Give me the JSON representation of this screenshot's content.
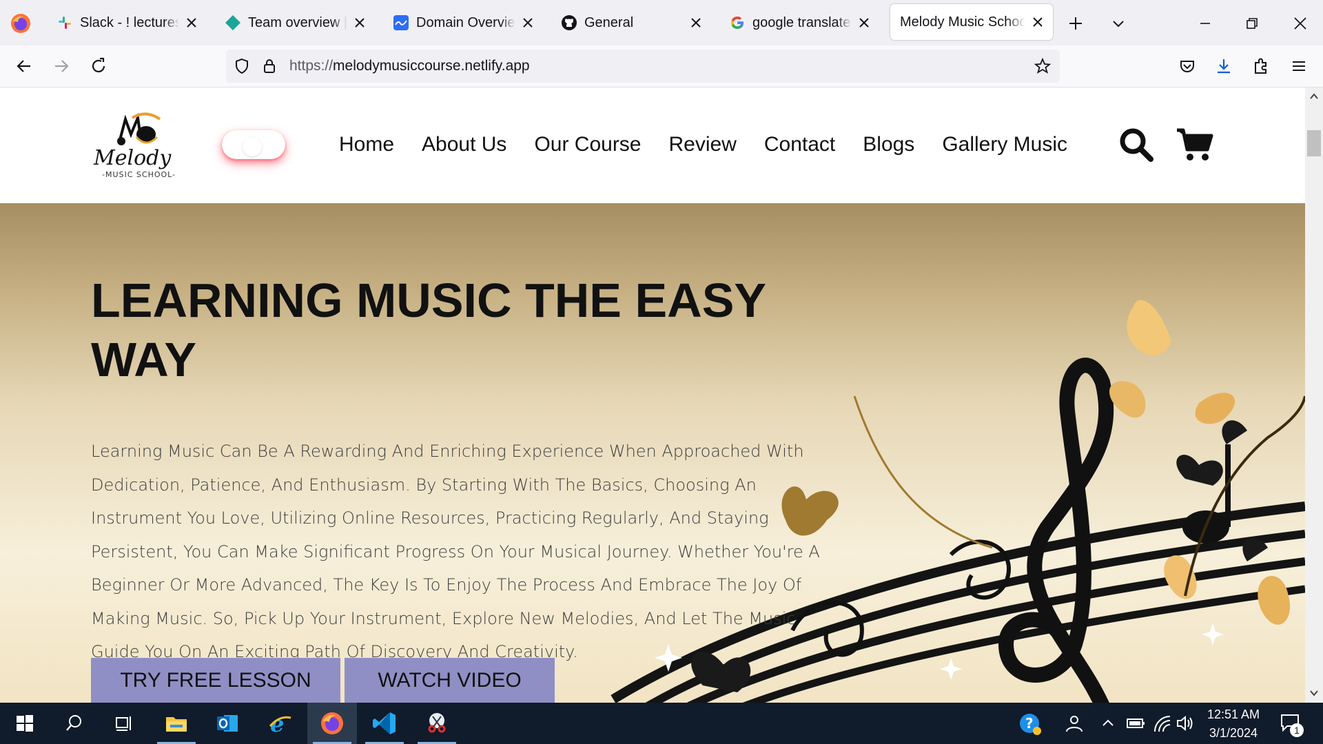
{
  "browser": {
    "tabs": [
      {
        "title": "Slack - ! lectures - F",
        "icon": "slack-icon"
      },
      {
        "title": "Team overview | nov",
        "icon": "diamond-icon"
      },
      {
        "title": "Domain Overview | S",
        "icon": "semrush-icon"
      },
      {
        "title": "General",
        "icon": "github-icon"
      },
      {
        "title": "google translate - P",
        "icon": "google-icon"
      },
      {
        "title": "Melody Music School",
        "icon": "none",
        "active": true
      }
    ],
    "url_protocol": "https://",
    "url_host": "melodymusiccourse.netlify.app"
  },
  "site": {
    "logo_sub": "-MUSIC SCHOOL-",
    "nav": [
      "Home",
      "About Us",
      "Our Course",
      "Review",
      "Contact",
      "Blogs",
      "Gallery Music"
    ],
    "hero": {
      "title": "LEARNING MUSIC THE EASY WAY",
      "text": "Learning Music Can Be A Rewarding And Enriching Experience When Approached With Dedication, Patience, And Enthusiasm. By Starting With The Basics, Choosing An Instrument You Love, Utilizing Online Resources, Practicing Regularly, And Staying Persistent, You Can Make Significant Progress On Your Musical Journey. Whether You're A Beginner Or More Advanced, The Key Is To Enjoy The Process And Embrace The Joy Of Making Music. So, Pick Up Your Instrument, Explore New Melodies, And Let The Music Guide You On An Exciting Path Of Discovery And Creativity.",
      "btn_primary": "TRY FREE LESSON",
      "btn_secondary": "WATCH VIDEO"
    }
  },
  "taskbar": {
    "time": "12:51 AM",
    "date": "3/1/2024",
    "notification_count": "1"
  },
  "colors": {
    "button_bg": "#8f8fc6",
    "hero_gold": "#c7b184",
    "taskbar_bg": "#101b2b"
  }
}
